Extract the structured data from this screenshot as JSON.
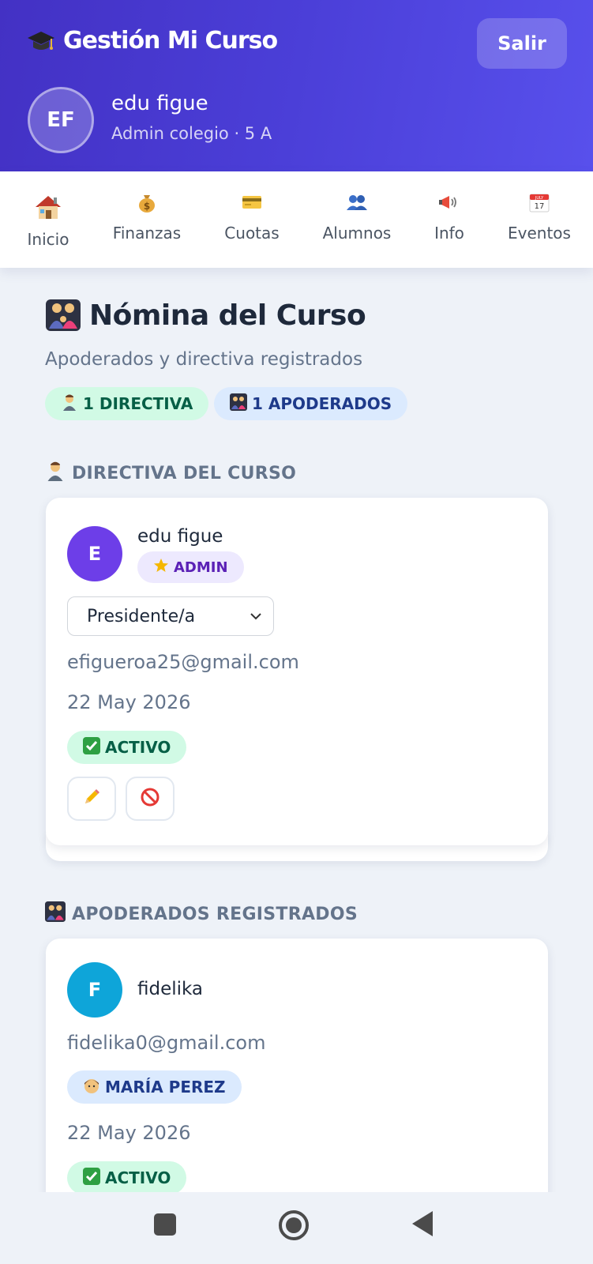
{
  "header": {
    "app_title": "Gestión Mi Curso",
    "logout_label": "Salir",
    "avatar_initials": "EF",
    "user_name": "edu figue",
    "user_role": "Admin colegio · 5 A"
  },
  "nav": {
    "items": [
      {
        "label": "Inicio",
        "icon": "house-icon"
      },
      {
        "label": "Finanzas",
        "icon": "money-bag-icon"
      },
      {
        "label": "Cuotas",
        "icon": "credit-card-icon"
      },
      {
        "label": "Alumnos",
        "icon": "people-icon"
      },
      {
        "label": "Info",
        "icon": "megaphone-icon"
      },
      {
        "label": "Eventos",
        "icon": "calendar-icon"
      }
    ],
    "calendar_day": "17",
    "calendar_month": "JULY"
  },
  "main": {
    "title": "Nómina del Curso",
    "subtitle": "Apoderados y directiva registrados",
    "pill_directiva": "1 DIRECTIVA",
    "pill_apoderados": "1 APODERADOS",
    "section_directiva": "DIRECTIVA DEL CURSO",
    "section_apoderados": "APODERADOS REGISTRADOS"
  },
  "directiva_card": {
    "avatar_initial": "E",
    "name": "edu figue",
    "role_badge": "ADMIN",
    "position_select": "Presidente/a",
    "email": "efigueroa25@gmail.com",
    "date": "22 May 2026",
    "status": "ACTIVO"
  },
  "apoderado_card": {
    "avatar_initial": "F",
    "name": "fidelika",
    "email": "fidelika0@gmail.com",
    "child": "MARÍA PEREZ",
    "date": "22 May 2026",
    "status": "ACTIVO"
  },
  "colors": {
    "header_gradient_start": "#4331c4",
    "header_gradient_end": "#5850ec",
    "admin_avatar": "#6d3ee8",
    "parent_avatar": "#0ea5d9",
    "status_green_bg": "#d1fae5",
    "status_green_text": "#065f46"
  }
}
